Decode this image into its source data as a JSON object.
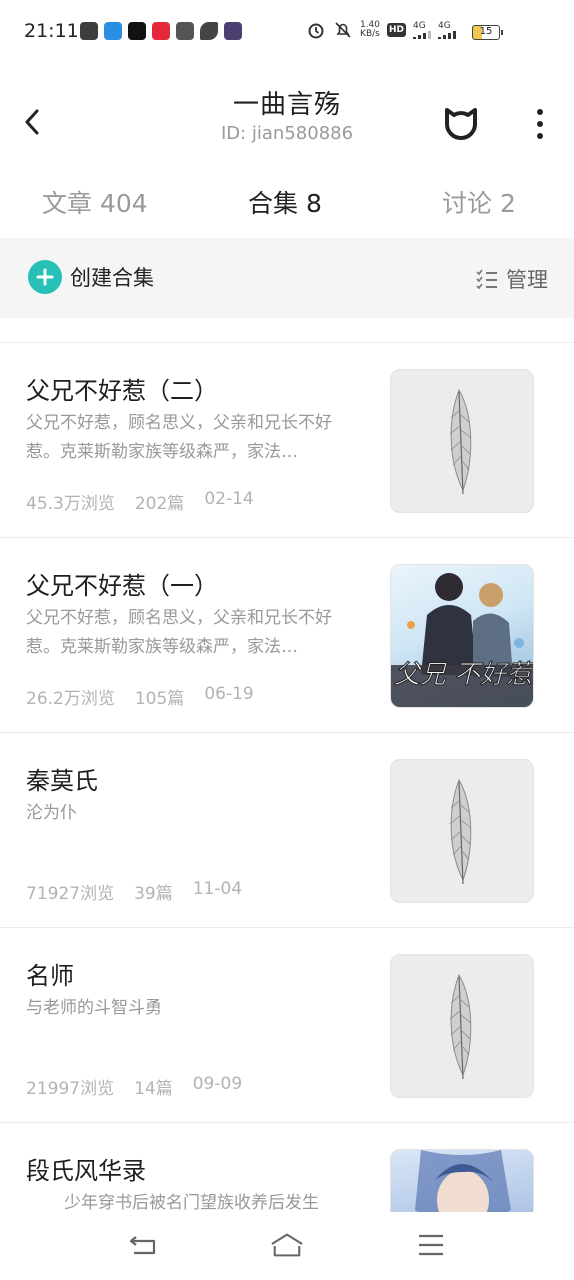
{
  "status_bar": {
    "time": "21:11",
    "net_speed": "1.40\nKB/s",
    "hd_label": "HD",
    "signal1": "4G",
    "signal2": "4G",
    "battery": "15"
  },
  "header": {
    "title": "一曲言殇",
    "user_id": "ID: jian580886"
  },
  "tabs": [
    {
      "label": "文章 404",
      "active": false
    },
    {
      "label": "合集 8",
      "active": true
    },
    {
      "label": "讨论 2",
      "active": false
    }
  ],
  "action_bar": {
    "create_label": "创建合集",
    "manage_label": "管理"
  },
  "collections": [
    {
      "title": "父兄不好惹（二）",
      "desc": "父兄不好惹，顾名思义，父亲和兄长不好惹。克莱斯勒家族等级森严，家法…",
      "views": "45.3万浏览",
      "count": "202篇",
      "date": "02-14",
      "cover": "leaf-placeholder"
    },
    {
      "title": "父兄不好惹（一）",
      "desc": "父兄不好惹，顾名思义，父亲和兄长不好惹。克莱斯勒家族等级森严，家法…",
      "views": "26.2万浏览",
      "count": "105篇",
      "date": "06-19",
      "cover": "illustration",
      "cover_text": "父兄\n不好惹"
    },
    {
      "title": "秦莫氏",
      "desc": "沦为仆",
      "views": "71927浏览",
      "count": "39篇",
      "date": "11-04",
      "cover": "leaf-placeholder"
    },
    {
      "title": "名师",
      "desc": "与老师的斗智斗勇",
      "views": "21997浏览",
      "count": "14篇",
      "date": "09-09",
      "cover": "leaf-placeholder"
    },
    {
      "title": "段氏风华录",
      "desc": "少年穿书后被名门望族收养后发生",
      "cover": "illustration-blue"
    }
  ],
  "colors": {
    "accent": "#26c0b6",
    "title": "#1e1e1e",
    "muted": "#999999",
    "meta": "#b3b3b3",
    "action_bg": "#f5f5f5"
  }
}
